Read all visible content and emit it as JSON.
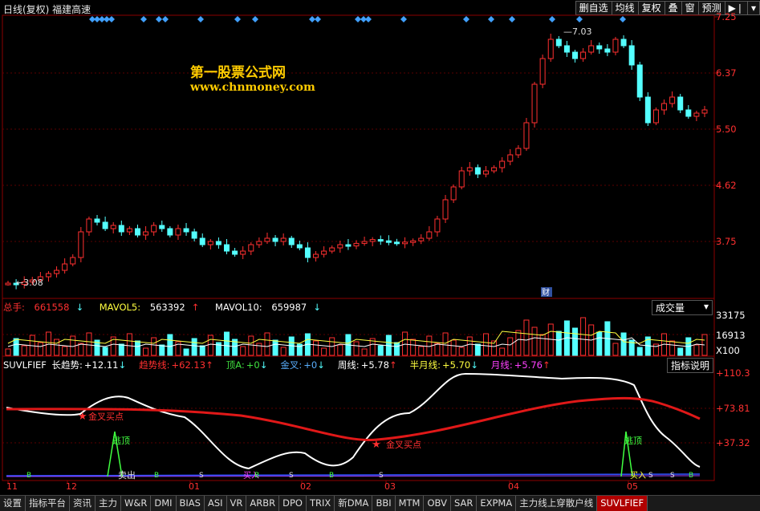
{
  "header": {
    "title": "日线(复权) 福建高速",
    "buttons": [
      "删自选",
      "均线",
      "复权",
      "叠",
      "窗",
      "预测"
    ],
    "nav_icon": "play-step-icon"
  },
  "watermark": {
    "line1": "第一股票公式网",
    "line2": "www.chnmoney.com"
  },
  "price_axis": [
    "7.25",
    "6.37",
    "5.50",
    "4.62",
    "3.75"
  ],
  "price_annotations": {
    "high": "7.03",
    "low": "3.08",
    "marker": "财"
  },
  "volume_panel": {
    "label_total": "总手:",
    "total": "661558",
    "label_ma5": "MAVOL5:",
    "ma5": "563392",
    "label_ma10": "MAVOL10:",
    "ma10": "659987",
    "dropdown": "成交量",
    "axis": [
      "33175",
      "16913",
      "X100"
    ]
  },
  "indicator_panel": {
    "name": "SUVLFIEF",
    "items": [
      {
        "label": "长趋势:",
        "value": "+12.11",
        "arrow": "↓",
        "color": "#ffffff"
      },
      {
        "label": "趋势线:",
        "value": "+62.13",
        "arrow": "↑",
        "color": "#ff3030"
      },
      {
        "label": "顶A:",
        "value": "+0",
        "arrow": "↓",
        "color": "#40e040"
      },
      {
        "label": "金叉:",
        "value": "+0",
        "arrow": "↓",
        "color": "#5ab0ff"
      },
      {
        "label": "周线:",
        "value": "+5.78",
        "arrow": "↑",
        "color": "#ffffff"
      },
      {
        "label": "半月线:",
        "value": "+5.70",
        "arrow": "↓",
        "color": "#ffff40"
      },
      {
        "label": "月线:",
        "value": "+5.76",
        "arrow": "↑",
        "color": "#ff40ff"
      }
    ],
    "help_button": "指标说明",
    "axis": [
      "+110.3",
      "+73.81",
      "+37.32"
    ],
    "annotations": {
      "buy1": "金叉买点",
      "buy2": "金叉买点",
      "top1": "逃顶",
      "top2": "逃顶",
      "sell": "卖出",
      "buyin1": "买入",
      "buyin2": "买入"
    }
  },
  "date_axis": [
    "11",
    "12",
    "01",
    "02",
    "03",
    "04",
    "05"
  ],
  "bottom_tabs": [
    "设置",
    "指标平台",
    "资讯",
    "主力",
    "W&R",
    "DMI",
    "BIAS",
    "ASI",
    "VR",
    "ARBR",
    "DPO",
    "TRIX",
    "新DMA",
    "BBI",
    "MTM",
    "OBV",
    "SAR",
    "EXPMA",
    "主力线上穿散户线",
    "SUVLFIEF"
  ],
  "active_tab": "SUVLFIEF",
  "colors": {
    "up": "#ff3030",
    "down": "#54ffff",
    "frame": "#8b0000"
  }
}
